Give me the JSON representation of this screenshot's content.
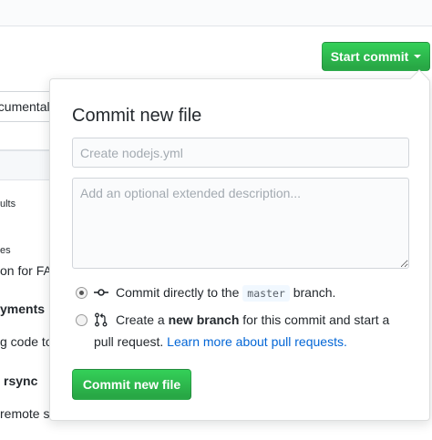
{
  "header": {
    "start_commit_label": "Start commit"
  },
  "background": {
    "input_text": "ocumental",
    "line_1": "ults",
    "line_2": "es",
    "line_3": "on for FA",
    "line_4": "yments",
    "line_5": "g code to",
    "line_6": "rsync",
    "line_7": "remote s"
  },
  "popover": {
    "title": "Commit new file",
    "summary_placeholder": "Create nodejs.yml",
    "description_placeholder": "Add an optional extended description...",
    "option_direct": {
      "before": "Commit directly to the",
      "branch": "master",
      "after": "branch."
    },
    "option_new_branch": {
      "before": "Create a",
      "bold": "new branch",
      "after": "for this commit and start a",
      "line2": "pull request.",
      "link": "Learn more about pull requests."
    },
    "commit_button_label": "Commit new file"
  }
}
